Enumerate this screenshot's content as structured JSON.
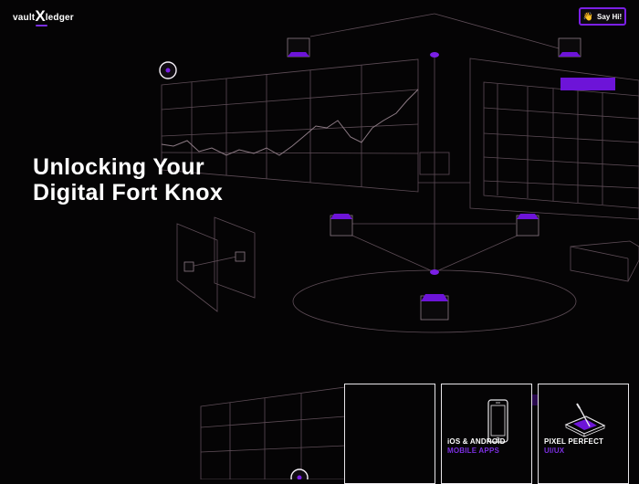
{
  "header": {
    "logo": {
      "part1": "vault",
      "part2": "X",
      "part3": "ledger"
    },
    "say_hi_label": "Say Hi!",
    "say_hi_icon": "waving-hand-icon"
  },
  "hero": {
    "headline_line1": "Unlocking Your",
    "headline_line2": "Digital Fort Knox"
  },
  "services": [
    {
      "title": "",
      "subtitle": "",
      "icon": ""
    },
    {
      "title": "iOS & ANDROID",
      "subtitle": "MOBILE APPS",
      "icon": "smartphone-icon"
    },
    {
      "title": "PIXEL PERFECT",
      "subtitle": "UI/UX",
      "icon": "tablet-stylus-icon"
    }
  ],
  "colors": {
    "background": "#050405",
    "accent": "#7b1fe6",
    "wireframe": "#6b5561"
  }
}
